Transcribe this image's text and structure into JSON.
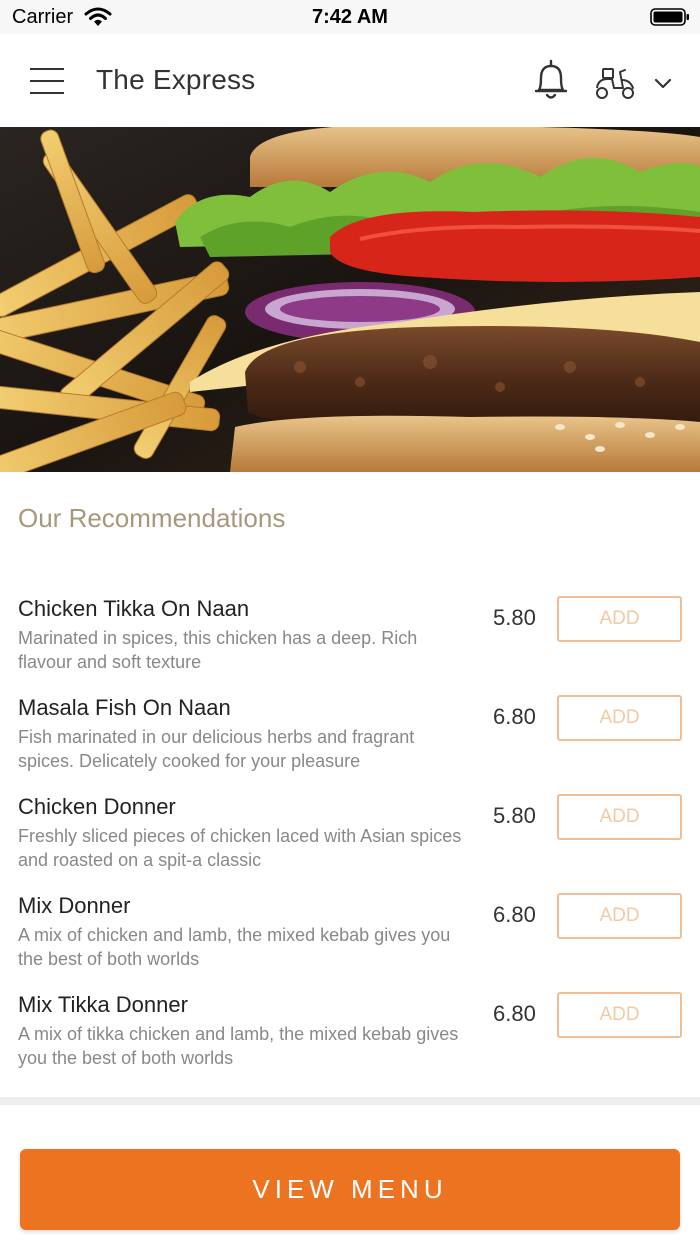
{
  "status_bar": {
    "carrier": "Carrier",
    "time": "7:42 AM"
  },
  "header": {
    "title": "The Express"
  },
  "icons": {
    "menu": "hamburger-icon",
    "notifications": "bell-icon",
    "delivery": "scooter-icon",
    "dropdown": "chevron-down-icon"
  },
  "hero": {
    "image": "burger-and-fries-photo"
  },
  "recommendations": {
    "title": "Our Recommendations",
    "add_label": "ADD",
    "items": [
      {
        "name": "Chicken Tikka On Naan",
        "description": "Marinated in spices, this chicken has a deep. Rich flavour and soft texture",
        "price": "5.80"
      },
      {
        "name": "Masala Fish On Naan",
        "description": "Fish marinated in our delicious herbs and fragrant spices. Delicately cooked for your pleasure",
        "price": "6.80"
      },
      {
        "name": "Chicken Donner",
        "description": "Freshly sliced pieces of chicken laced with Asian spices and roasted on a spit-a classic",
        "price": "5.80"
      },
      {
        "name": "Mix Donner",
        "description": "A mix of chicken and lamb, the mixed kebab gives you the best of both worlds",
        "price": "6.80"
      },
      {
        "name": "Mix Tikka Donner",
        "description": "A mix of tikka chicken and lamb, the mixed kebab gives you the best of both worlds",
        "price": "6.80"
      }
    ]
  },
  "footer": {
    "view_menu_label": "VIEW MENU"
  },
  "colors": {
    "accent": "#ec7420",
    "add_border": "#f0bd95",
    "section_title": "#a8987a"
  }
}
